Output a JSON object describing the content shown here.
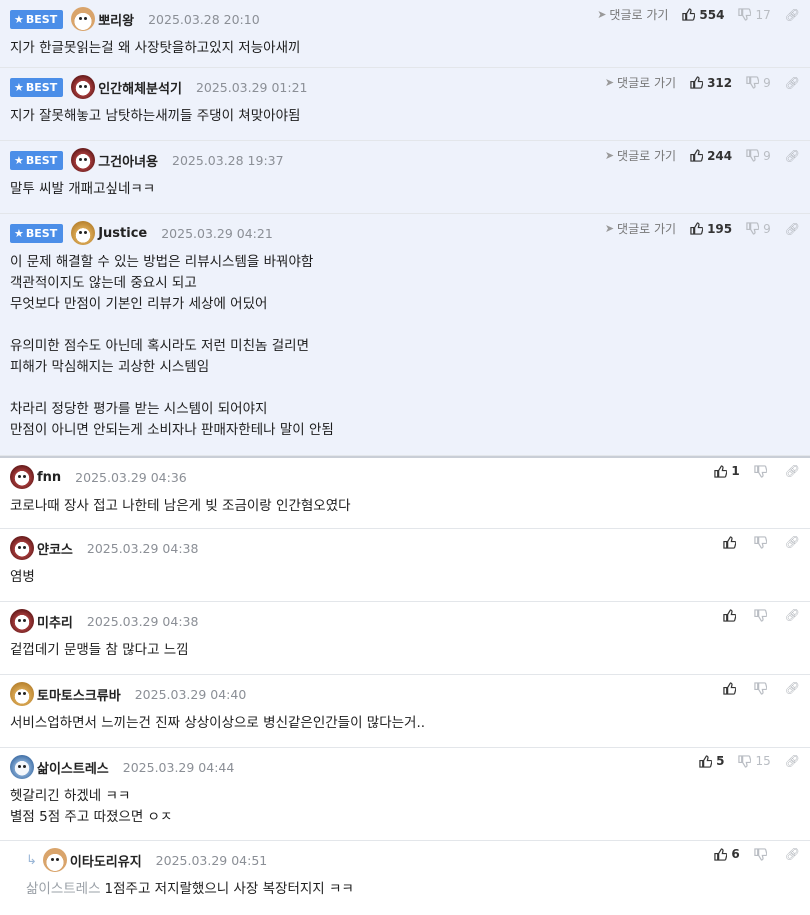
{
  "best_label": "BEST",
  "goto_label": "댓글로 가기",
  "comments": [
    {
      "nick": "뽀리왕",
      "date": "2025.03.28 20:10",
      "up": "554",
      "down": "17",
      "body": "지가 한글못읽는걸 왜 사장탓을하고있지 저능아새끼"
    },
    {
      "nick": "인간해체분석기",
      "date": "2025.03.29 01:21",
      "up": "312",
      "down": "9",
      "body": "지가 잘못해놓고 남탓하는새끼들 주댕이 쳐맞아야됨"
    },
    {
      "nick": "그건아녀용",
      "date": "2025.03.28 19:37",
      "up": "244",
      "down": "9",
      "body": "말투 씨발 개패고싶네ㅋㅋ"
    },
    {
      "nick": "Justice",
      "date": "2025.03.29 04:21",
      "up": "195",
      "down": "9",
      "body": "이 문제 해결할 수 있는 방법은 리뷰시스템을 바꿔야함\n객관적이지도 않는데 중요시 되고\n무엇보다 만점이 기본인 리뷰가 세상에 어딨어\n\n유의미한 점수도 아닌데 혹시라도 저런 미친놈 걸리면\n피해가 막심해지는 괴상한 시스템임\n\n차라리 정당한 평가를 받는 시스템이 되어야지\n만점이 아니면 안되는게 소비자나 판매자한테나 말이 안됨"
    },
    {
      "nick": "fnn",
      "date": "2025.03.29 04:36",
      "up": "1",
      "down": "",
      "body": "코로나때 장사 접고 나한테 남은게 빚 조금이랑 인간혐오였다"
    },
    {
      "nick": "얀코스",
      "date": "2025.03.29 04:38",
      "up": "",
      "down": "",
      "body": "염병"
    },
    {
      "nick": "미추리",
      "date": "2025.03.29 04:38",
      "up": "",
      "down": "",
      "body": "겉껍데기 문맹들 참 많다고 느낌"
    },
    {
      "nick": "토마토스크류바",
      "date": "2025.03.29 04:40",
      "up": "",
      "down": "",
      "body": "서비스업하면서 느끼는건 진짜 상상이상으로 병신같은인간들이 많다는거.."
    },
    {
      "nick": "삶이스트레스",
      "date": "2025.03.29 04:44",
      "up": "5",
      "down": "15",
      "body": "헷갈리긴 하겠네 ㅋㅋ\n별점 5점 주고 따졌으면 ㅇㅈ"
    },
    {
      "nick": "이타도리유지",
      "date": "2025.03.29 04:51",
      "up": "6",
      "down": "",
      "reply_to": "삶이스트레스",
      "body": "1점주고 저지랄했으니 사장 복장터지지 ㅋㅋ"
    }
  ]
}
